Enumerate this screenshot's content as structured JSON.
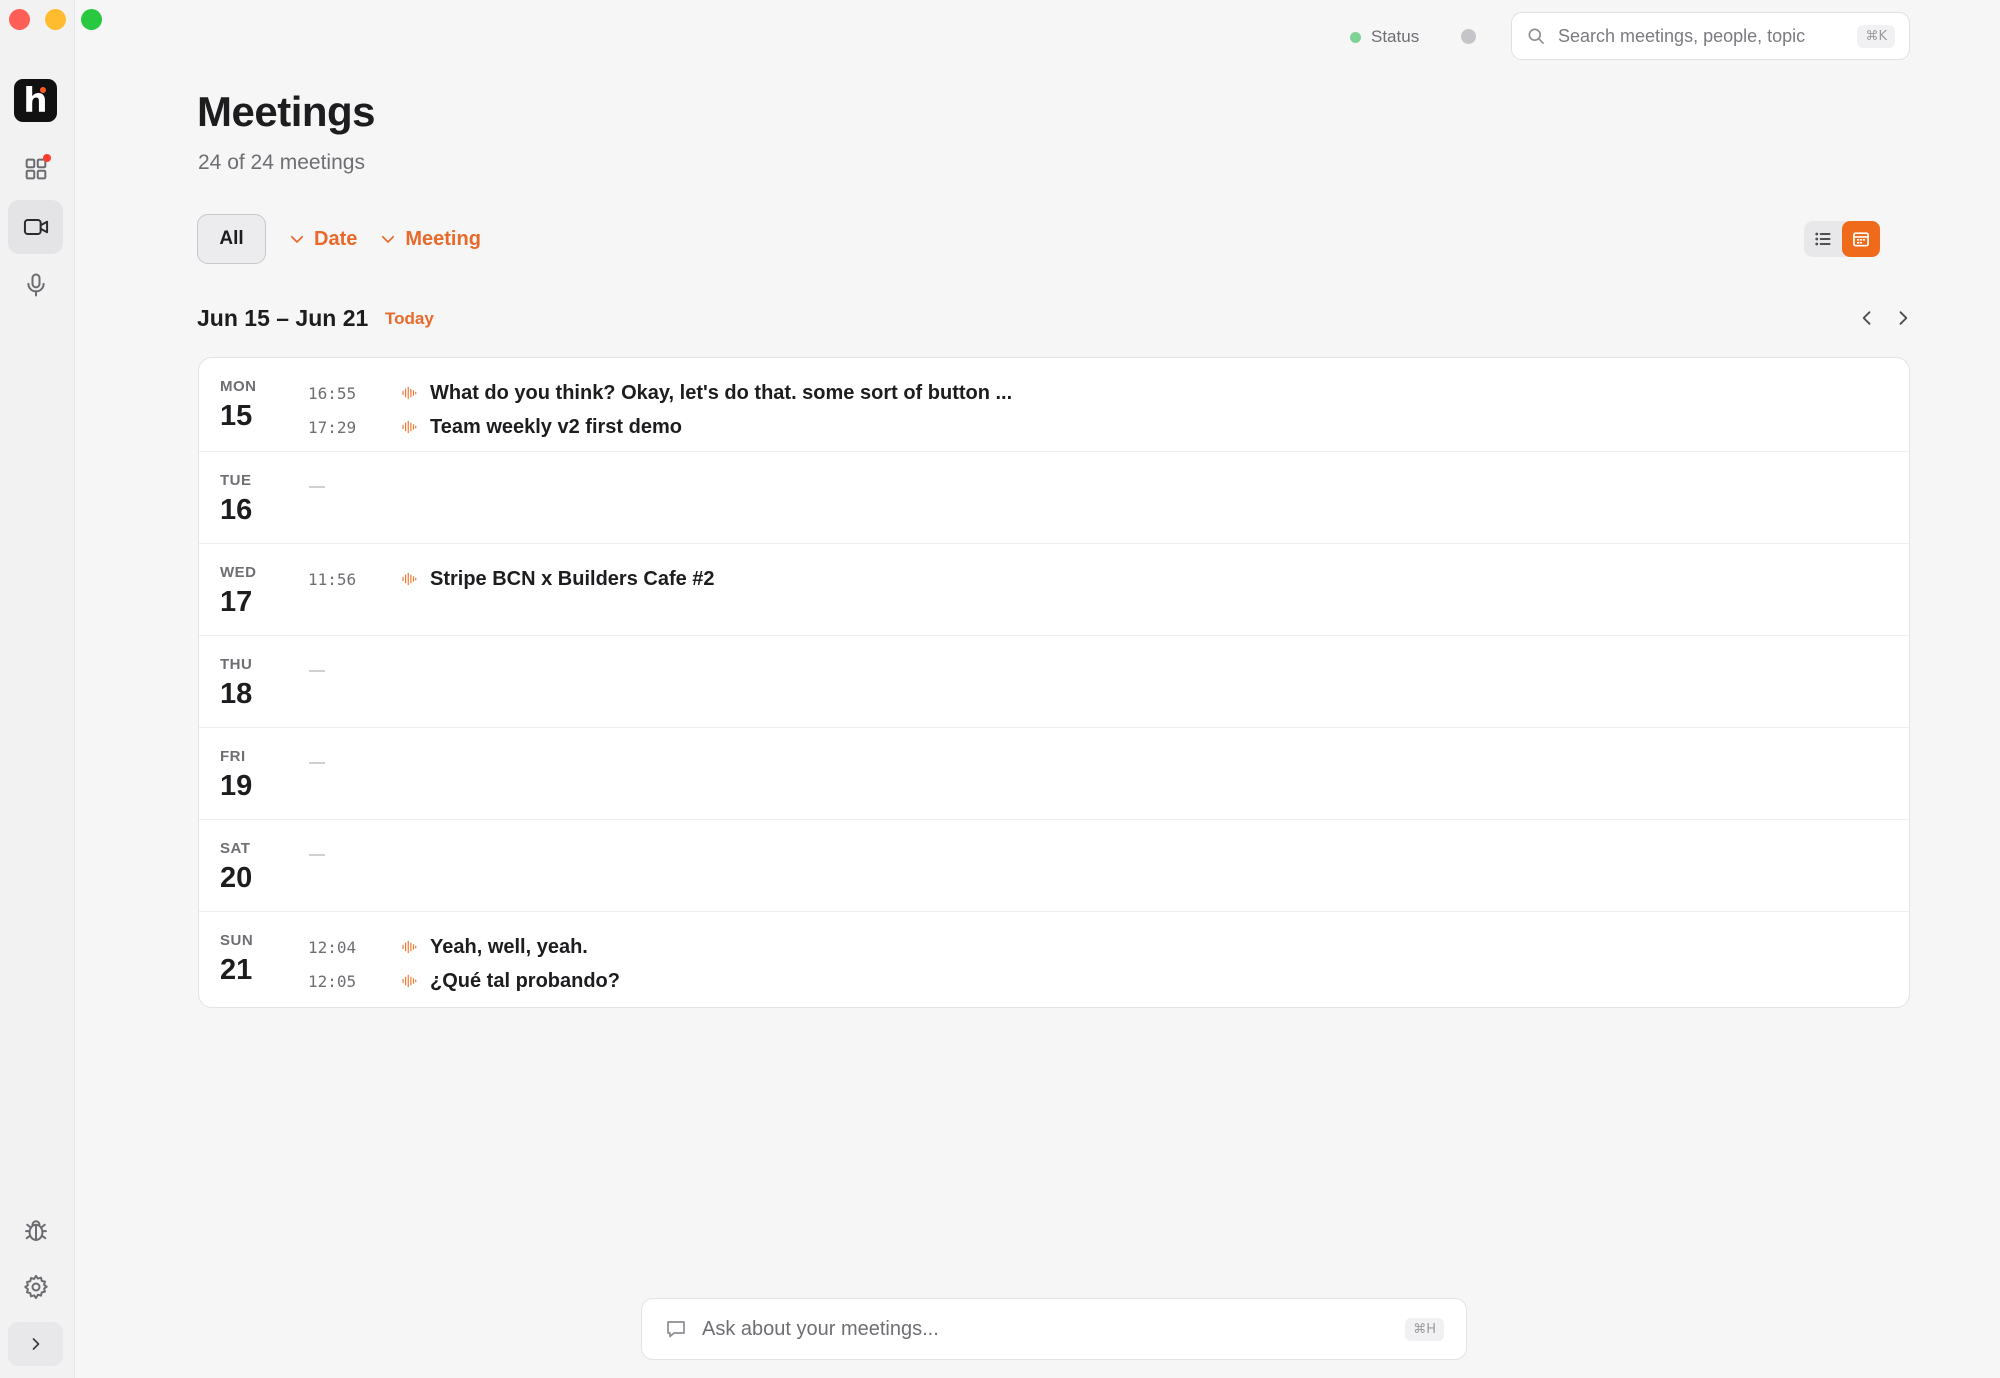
{
  "window": {
    "controls": [
      "close",
      "minimize",
      "zoom"
    ]
  },
  "sidebar": {
    "logo_letter": "h",
    "items": [
      {
        "name": "dashboard",
        "icon": "grid-icon",
        "notification": true
      },
      {
        "name": "meetings",
        "icon": "video-camera-icon",
        "active": true
      },
      {
        "name": "recordings",
        "icon": "microphone-icon"
      }
    ],
    "bottom": [
      {
        "name": "bug-report",
        "icon": "bug-icon"
      },
      {
        "name": "settings",
        "icon": "gear-icon"
      },
      {
        "name": "expand",
        "icon": "chevron-right-icon"
      }
    ]
  },
  "topbar": {
    "status_label": "Status",
    "status_color": "#7ed394",
    "search": {
      "placeholder": "Search meetings, people, topic",
      "shortcut": "⌘K"
    }
  },
  "header": {
    "title": "Meetings",
    "subtitle": "24 of 24 meetings"
  },
  "filters": {
    "all_label": "All",
    "date_label": "Date",
    "meeting_label": "Meeting",
    "accent_color": "#e8692a"
  },
  "week": {
    "range": "Jun 15 – Jun 21",
    "today_label": "Today",
    "days": [
      {
        "dow": "MON",
        "num": "15",
        "meetings": [
          {
            "time": "16:55",
            "title": "What do you think? Okay, let's do that. some sort of button ..."
          },
          {
            "time": "17:29",
            "title": "Team weekly v2 first demo"
          }
        ]
      },
      {
        "dow": "TUE",
        "num": "16",
        "meetings": []
      },
      {
        "dow": "WED",
        "num": "17",
        "meetings": [
          {
            "time": "11:56",
            "title": "Stripe BCN x Builders Cafe #2"
          }
        ]
      },
      {
        "dow": "THU",
        "num": "18",
        "meetings": []
      },
      {
        "dow": "FRI",
        "num": "19",
        "meetings": []
      },
      {
        "dow": "SAT",
        "num": "20",
        "meetings": []
      },
      {
        "dow": "SUN",
        "num": "21",
        "meetings": [
          {
            "time": "12:04",
            "title": "Yeah, well, yeah."
          },
          {
            "time": "12:05",
            "title": "¿Qué tal probando?"
          }
        ]
      }
    ]
  },
  "ask": {
    "placeholder": "Ask about your meetings...",
    "shortcut": "⌘H"
  }
}
